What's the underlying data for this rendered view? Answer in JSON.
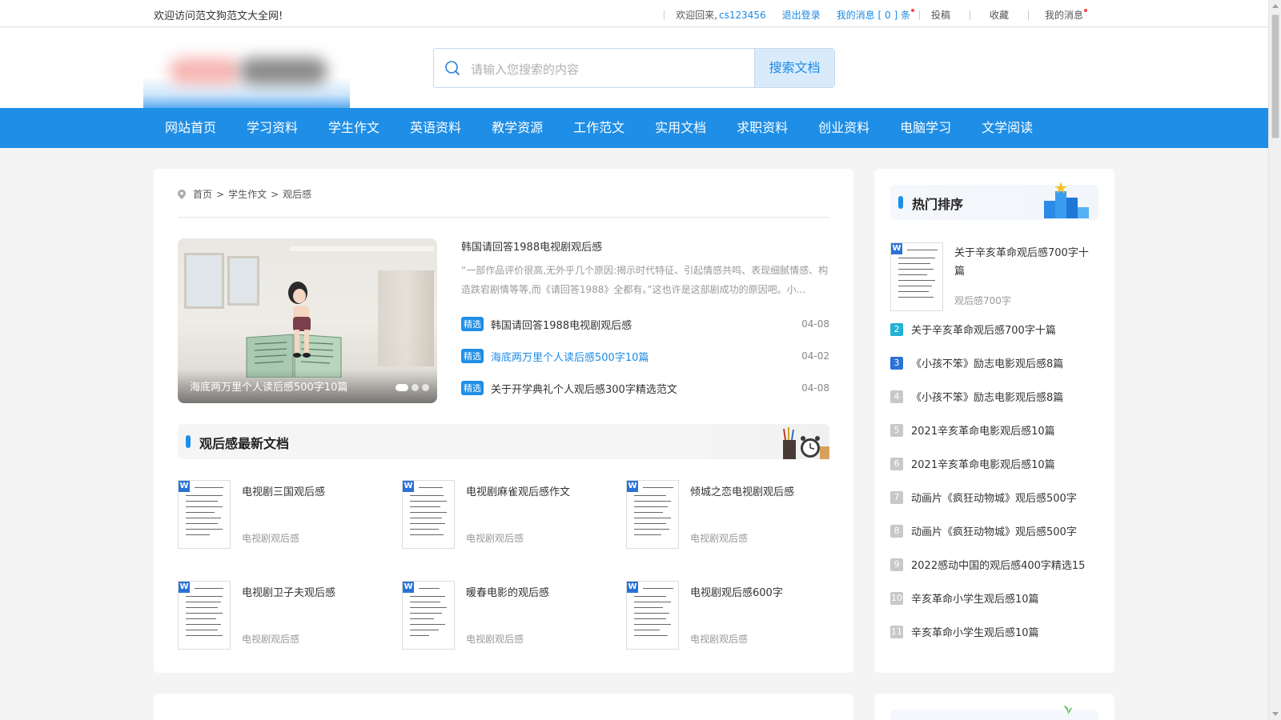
{
  "topbar": {
    "welcome": "欢迎访问范文狗范文大全网!",
    "welcome_back": "欢迎回来,",
    "username": "cs123456",
    "logout": "退出登录",
    "messages": "我的消息 [ 0 ] 条",
    "submit": "投稿",
    "favorites": "收藏",
    "my_messages": "我的消息"
  },
  "search": {
    "placeholder": "请输入您搜索的内容",
    "button": "搜索文档"
  },
  "nav": [
    "网站首页",
    "学习资料",
    "学生作文",
    "英语资料",
    "教学资源",
    "工作范文",
    "实用文档",
    "求职资料",
    "创业资料",
    "电脑学习",
    "文学阅读"
  ],
  "breadcrumb": [
    "首页",
    "学生作文",
    "观后感"
  ],
  "hero": {
    "caption": "海底两万里个人读后感500字10篇"
  },
  "featured": {
    "title": "韩国请回答1988电视剧观后感",
    "desc": "“一部作品评价很高,无外乎几个原因:揭示时代特征、引起情感共鸣、表现细腻情感、构造跌宕剧情等等,而《请回答1988》全都有。”这也许是这部剧成功的原因吧。小...",
    "items": [
      {
        "tag": "精选",
        "title": "韩国请回答1988电视剧观后感",
        "date": "04-08"
      },
      {
        "tag": "精选",
        "title": "海底两万里个人读后感500字10篇",
        "date": "04-02"
      },
      {
        "tag": "精选",
        "title": "关于开学典礼个人观后感300字精选范文",
        "date": "04-08"
      }
    ]
  },
  "latest": {
    "title": "观后感最新文档",
    "docs": [
      {
        "title": "电视剧三国观后感",
        "category": "电视剧观后感"
      },
      {
        "title": "电视剧麻雀观后感作文",
        "category": "电视剧观后感"
      },
      {
        "title": "倾城之恋电视剧观后感",
        "category": "电视剧观后感"
      },
      {
        "title": "电视剧卫子夫观后感",
        "category": "电视剧观后感"
      },
      {
        "title": "暖春电影的观后感",
        "category": "电视剧观后感"
      },
      {
        "title": "电视剧观后感600字",
        "category": "电视剧观后感"
      }
    ]
  },
  "hot": {
    "title": "热门排序",
    "top": {
      "title": "关于辛亥革命观后感700字十篇",
      "category": "观后感700字"
    },
    "items": [
      {
        "rank": "2",
        "title": "关于辛亥革命观后感700字十篇",
        "color": "#1fb3d6"
      },
      {
        "rank": "3",
        "title": "《小孩不笨》励志电影观后感8篇",
        "color": "#2b72d6"
      },
      {
        "rank": "4",
        "title": "《小孩不笨》励志电影观后感8篇",
        "color": "#c8c8c8"
      },
      {
        "rank": "5",
        "title": "2021辛亥革命电影观后感10篇",
        "color": "#c8c8c8"
      },
      {
        "rank": "6",
        "title": "2021辛亥革命电影观后感10篇",
        "color": "#c8c8c8"
      },
      {
        "rank": "7",
        "title": "动画片《疯狂动物城》观后感500字",
        "color": "#c8c8c8"
      },
      {
        "rank": "8",
        "title": "动画片《疯狂动物城》观后感500字",
        "color": "#c8c8c8"
      },
      {
        "rank": "9",
        "title": "2022感动中国的观后感400字精选15",
        "color": "#c8c8c8"
      },
      {
        "rank": "10",
        "title": "辛亥革命小学生观后感10篇",
        "color": "#c8c8c8"
      },
      {
        "rank": "11",
        "title": "辛亥革命小学生观后感10篇",
        "color": "#c8c8c8"
      }
    ]
  },
  "colors": {
    "brand": "#1e8ee6",
    "link": "#1a8ae6"
  }
}
